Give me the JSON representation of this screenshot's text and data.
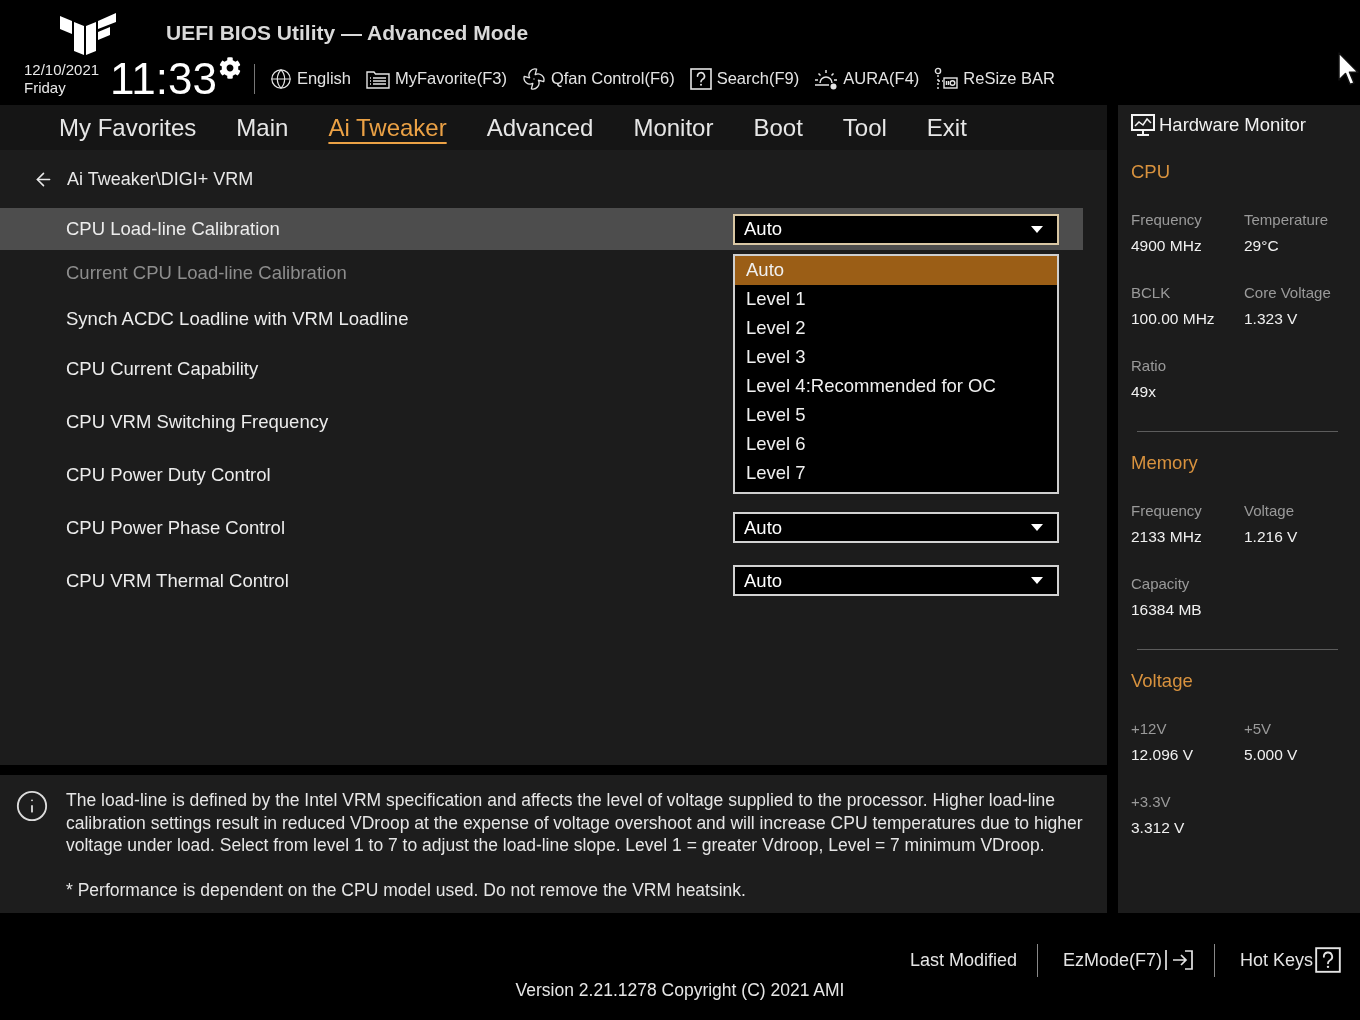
{
  "header": {
    "title": "UEFI BIOS Utility — Advanced Mode",
    "date": "12/10/2021",
    "day": "Friday",
    "time": "11:33",
    "toolbar": [
      {
        "kind": "language",
        "label": "English"
      },
      {
        "kind": "favorites",
        "label": "MyFavorite(F3)"
      },
      {
        "kind": "fan",
        "label": "Qfan Control(F6)"
      },
      {
        "kind": "search",
        "label": "Search(F9)"
      },
      {
        "kind": "aura",
        "label": "AURA(F4)"
      },
      {
        "kind": "resize_bar",
        "label": "ReSize BAR"
      }
    ]
  },
  "menu": [
    {
      "label": "My Favorites",
      "selected": false
    },
    {
      "label": "Main",
      "selected": false
    },
    {
      "label": "Ai Tweaker",
      "selected": true
    },
    {
      "label": "Advanced",
      "selected": false
    },
    {
      "label": "Monitor",
      "selected": false
    },
    {
      "label": "Boot",
      "selected": false
    },
    {
      "label": "Tool",
      "selected": false
    },
    {
      "label": "Exit",
      "selected": false
    }
  ],
  "breadcrumb": "Ai Tweaker\\DIGI+ VRM",
  "settings": [
    {
      "label": "CPU Load-line Calibration",
      "selected": true,
      "disabled": false,
      "value": "Auto",
      "options": [
        {
          "label": "Auto",
          "selected": true
        },
        {
          "label": "Level 1",
          "selected": false
        },
        {
          "label": "Level 2",
          "selected": false
        },
        {
          "label": "Level 3",
          "selected": false
        },
        {
          "label": "Level 4:Recommended for OC",
          "selected": false
        },
        {
          "label": "Level 5",
          "selected": false
        },
        {
          "label": "Level 6",
          "selected": false
        },
        {
          "label": "Level 7",
          "selected": false
        }
      ]
    },
    {
      "label": "Current CPU Load-line Calibration",
      "selected": false,
      "disabled": true
    },
    {
      "label": "Synch ACDC Loadline with VRM Loadline",
      "selected": false,
      "disabled": false
    },
    {
      "label": "CPU Current Capability",
      "selected": false,
      "disabled": false
    },
    {
      "label": "CPU VRM Switching Frequency",
      "selected": false,
      "disabled": false
    },
    {
      "label": "CPU Power Duty Control",
      "selected": false,
      "disabled": false
    },
    {
      "label": "CPU Power Phase Control",
      "selected": false,
      "disabled": false,
      "value": "Auto"
    },
    {
      "label": "CPU VRM Thermal Control",
      "selected": false,
      "disabled": false,
      "value": "Auto"
    }
  ],
  "help": {
    "paragraphs": [
      "The load-line is defined by the Intel VRM specification and affects the level of voltage supplied to the processor. Higher load-line calibration settings result in reduced VDroop at the expense of voltage overshoot and will increase CPU temperatures due to higher voltage under load. Select from level 1 to 7 to adjust the load-line slope. Level 1 = greater Vdroop, Level = 7 minimum VDroop.",
      "* Performance is dependent on the CPU model used. Do not remove the VRM heatsink."
    ]
  },
  "hardware_monitor": {
    "title": "Hardware Monitor",
    "sections": [
      {
        "title": "CPU",
        "items": [
          {
            "label": "Frequency",
            "value": "4900 MHz"
          },
          {
            "label": "Temperature",
            "value": "29°C"
          },
          {
            "label": "BCLK",
            "value": "100.00 MHz"
          },
          {
            "label": "Core Voltage",
            "value": "1.323 V"
          },
          {
            "label": "Ratio",
            "value": "49x"
          }
        ]
      },
      {
        "title": "Memory",
        "items": [
          {
            "label": "Frequency",
            "value": "2133 MHz"
          },
          {
            "label": "Voltage",
            "value": "1.216 V"
          },
          {
            "label": "Capacity",
            "value": "16384 MB"
          }
        ]
      },
      {
        "title": "Voltage",
        "items": [
          {
            "label": "+12V",
            "value": "12.096 V"
          },
          {
            "label": "+5V",
            "value": "5.000 V"
          },
          {
            "label": "+3.3V",
            "value": "3.312 V"
          }
        ]
      }
    ]
  },
  "footer": {
    "actions": [
      {
        "kind": "last_modified",
        "label": "Last Modified"
      },
      {
        "kind": "ez_mode",
        "label": "EzMode(F7)"
      },
      {
        "kind": "hot_keys",
        "label": "Hot Keys"
      }
    ],
    "version": "Version 2.21.1278 Copyright (C) 2021 AMI"
  }
}
